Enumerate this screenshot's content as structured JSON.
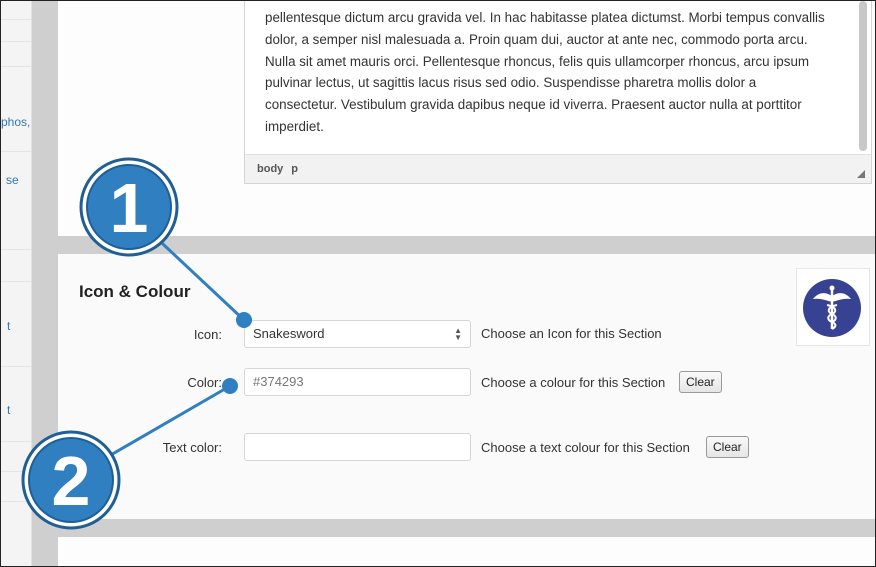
{
  "sidebar": {
    "fragments": [
      "phos,",
      "se",
      "t",
      "t"
    ]
  },
  "editor": {
    "lines": [
      "pellentesque dictum arcu gravida vel. In hac habitasse platea dictumst. Morbi tempus convallis",
      "dolor, a semper nisl malesuada a. Proin quam dui, auctor at ante nec, commodo porta arcu.",
      "Nulla sit amet mauris orci. Pellentesque rhoncus, felis quis ullamcorper rhoncus, arcu ipsum",
      "pulvinar lectus, ut sagittis lacus risus sed odio. Suspendisse pharetra mollis dolor a",
      "consectetur. Vestibulum gravida dapibus neque id viverra. Praesent auctor nulla at porttitor",
      "imperdiet."
    ],
    "path": [
      "body",
      "p"
    ]
  },
  "section": {
    "title": "Icon & Colour",
    "icon": {
      "label": "Icon:",
      "value": "Snakesword",
      "hint": "Choose an Icon for this Section",
      "icon_name": "caduceus-icon"
    },
    "color": {
      "label": "Color:",
      "value": "#374293",
      "hint": "Choose a colour for this Section",
      "clear_label": "Clear"
    },
    "text_color": {
      "label": "Text color:",
      "value": "",
      "hint": "Choose a text colour for this Section",
      "clear_label": "Clear"
    }
  },
  "callouts": {
    "one": "1",
    "two": "2"
  },
  "colors": {
    "accent": "#374293",
    "callout": "#2f7fc1",
    "link": "#2f78b5"
  }
}
